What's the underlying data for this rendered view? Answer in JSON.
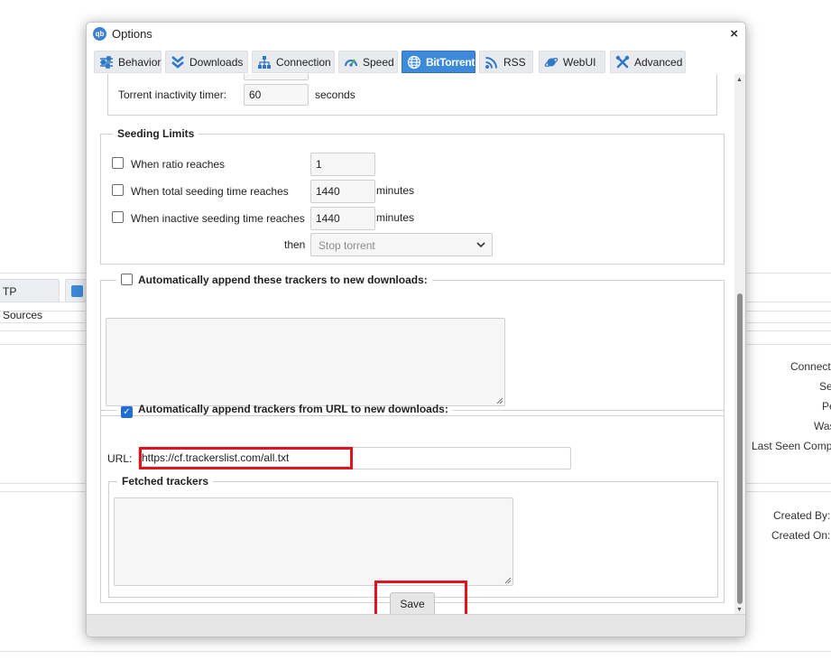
{
  "background": {
    "tabs": [
      "TP Sources",
      ""
    ],
    "right_labels": [
      "Connect",
      "Se",
      "Pe",
      "Was",
      "Last Seen Comp",
      "Created By:",
      "Created On:"
    ]
  },
  "dialog": {
    "logo_text": "qb",
    "title": "Options",
    "close_label": "×",
    "tabs": [
      {
        "label": "Behavior",
        "icon": "sliders-icon"
      },
      {
        "label": "Downloads",
        "icon": "double-chevron-down-icon"
      },
      {
        "label": "Connection",
        "icon": "network-icon"
      },
      {
        "label": "Speed",
        "icon": "speedometer-icon"
      },
      {
        "label": "BitTorrent",
        "icon": "globe-icon",
        "active": true
      },
      {
        "label": "RSS",
        "icon": "rss-icon"
      },
      {
        "label": "WebUI",
        "icon": "satellite-icon"
      },
      {
        "label": "Advanced",
        "icon": "tools-icon"
      }
    ]
  },
  "queue": {
    "inactivity_label": "Torrent inactivity timer:",
    "inactivity_value": "60",
    "inactivity_unit": "seconds"
  },
  "seeding_limits": {
    "legend": "Seeding Limits",
    "ratio_label": "When ratio reaches",
    "ratio_value": "1",
    "ratio_checked": false,
    "seeding_time_label": "When total seeding time reaches",
    "seeding_time_value": "1440",
    "seeding_time_unit": "minutes",
    "seeding_time_checked": false,
    "inactive_time_label": "When inactive seeding time reaches",
    "inactive_time_value": "1440",
    "inactive_time_unit": "minutes",
    "inactive_time_checked": false,
    "then_label": "then",
    "action_value": "Stop torrent"
  },
  "auto_trackers": {
    "label": "Automatically append these trackers to new downloads:",
    "checked": false,
    "text": ""
  },
  "url_trackers": {
    "label": "Automatically append trackers from URL to new downloads:",
    "checked": true,
    "url_label": "URL:",
    "url_value": "https://cf.trackerslist.com/all.txt",
    "fetched_legend": "Fetched trackers",
    "fetched_text": ""
  },
  "save_label": "Save",
  "highlight_color": "#e0141e",
  "accent_color": "#3c8ad9"
}
